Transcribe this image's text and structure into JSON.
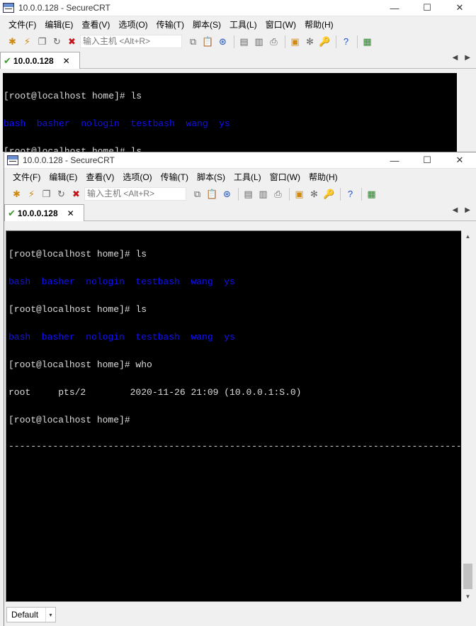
{
  "window": {
    "title": "10.0.0.128 - SecureCRT",
    "controls": {
      "minimize": "—",
      "maximize": "☐",
      "close": "✕"
    }
  },
  "menu": {
    "file": "文件(F)",
    "edit": "编辑(E)",
    "view": "查看(V)",
    "options": "选项(O)",
    "transfer": "传输(T)",
    "script": "脚本(S)",
    "tools": "工具(L)",
    "window": "窗口(W)",
    "help": "帮助(H)"
  },
  "toolbar": {
    "quick_connect_placeholder": "输入主机 <Alt+R>",
    "icons": [
      "connect-icon",
      "quick-connect-icon",
      "connect-tab-icon",
      "reconnect-icon",
      "disconnect-icon",
      "copy-icon",
      "paste-icon",
      "find-icon",
      "print-icon",
      "print-screen-icon",
      "printer-icon",
      "session-options-icon",
      "global-options-icon",
      "keymap-icon",
      "help-icon",
      "sftp-icon"
    ]
  },
  "tab": {
    "label": "10.0.0.128",
    "close": "✕",
    "prev": "◀",
    "next": "▶"
  },
  "terminal": {
    "lines": [
      {
        "text": "[root@localhost home]# ls",
        "color": "default"
      },
      {
        "text": "bash  basher  nologin  testbash  wang  ys",
        "color": "blue"
      },
      {
        "text": "[root@localhost home]# ls",
        "color": "default"
      },
      {
        "text": "bash  basher  nologin  testbash  wang  ys",
        "color": "blue"
      },
      {
        "text": "[root@localhost home]# who",
        "color": "default"
      },
      {
        "text": "root     pts/2        2020-11-26 21:09 (10.0.0.1:S.0)",
        "color": "default"
      },
      {
        "text": "[root@localhost home]#",
        "color": "default"
      }
    ],
    "divider": "--------------------------------------------------------------------------------------------------------",
    "colors": {
      "background": "#000000",
      "foreground": "#dddddd",
      "blue": "#1010ff"
    }
  },
  "status": {
    "session_options": "Default",
    "combo_arrow": "▾"
  }
}
